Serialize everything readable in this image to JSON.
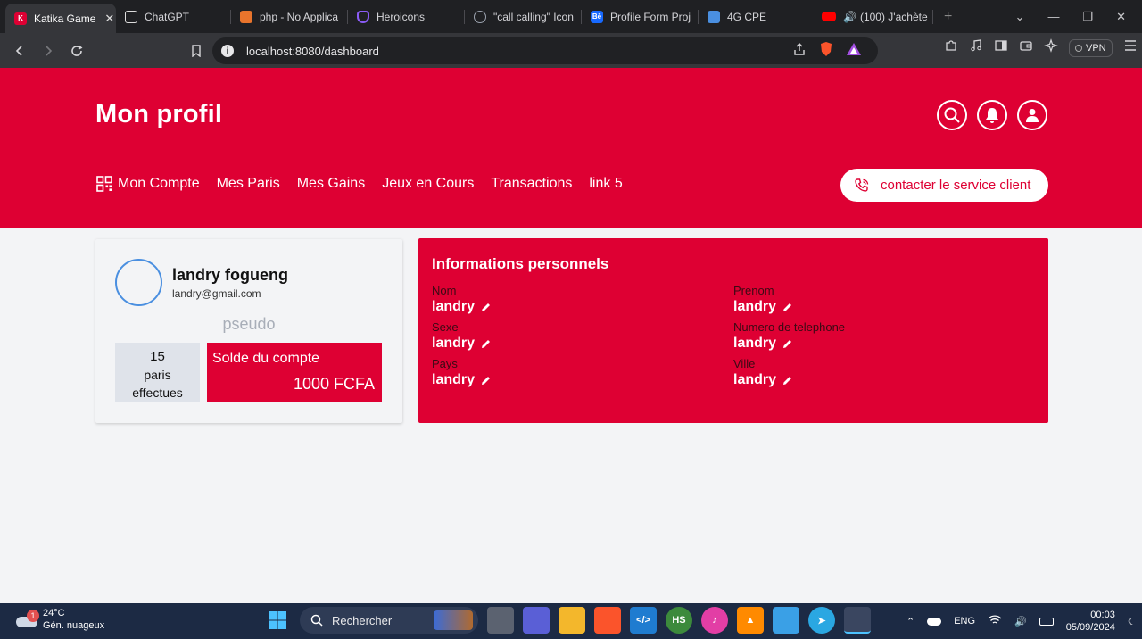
{
  "browser": {
    "tabs": [
      {
        "label": "Katika Game",
        "active": true,
        "color": "#de0033"
      },
      {
        "label": "ChatGPT",
        "active": false,
        "color": "#ffffff"
      },
      {
        "label": "php - No Applica",
        "active": false,
        "color": "#e8742c"
      },
      {
        "label": "Heroicons",
        "active": false,
        "color": "#8b5cf6"
      },
      {
        "label": "\"call calling\" Icon",
        "active": false,
        "color": "#9ca3af"
      },
      {
        "label": "Profile Form Proj",
        "active": false,
        "color": "#1769ff"
      },
      {
        "label": "4G CPE",
        "active": false,
        "color": "#4a8fe0"
      },
      {
        "label": "(100) J'achète",
        "active": false,
        "color": "#ff0000"
      }
    ],
    "url_host": "localhost",
    "url_path": ":8080/dashboard",
    "vpn_label": "VPN"
  },
  "header": {
    "title": "Mon profil",
    "nav": [
      "Mon Compte",
      "Mes Paris",
      "Mes Gains",
      "Jeux en Cours",
      "Transactions",
      "link 5"
    ],
    "contact_label": "contacter le service client"
  },
  "profile": {
    "name": "landry fogueng",
    "email": "landry@gmail.com",
    "pseudo": "pseudo",
    "paris_count": "15",
    "paris_label_1": "paris",
    "paris_label_2": "effectues",
    "solde_label": "Solde du compte",
    "solde_amount": "1000 FCFA"
  },
  "info": {
    "title": "Informations personnels",
    "fields": [
      {
        "label": "Nom",
        "value": "landry"
      },
      {
        "label": "Prenom",
        "value": "landry"
      },
      {
        "label": "Sexe",
        "value": "landry"
      },
      {
        "label": "Numero de telephone",
        "value": "landry"
      },
      {
        "label": "Pays",
        "value": "landry"
      },
      {
        "label": "Ville",
        "value": "landry"
      }
    ]
  },
  "taskbar": {
    "temperature": "24°C",
    "weather": "Gén. nuageux",
    "weather_badge": "1",
    "search_label": "Rechercher",
    "lang": "ENG",
    "time": "00:03",
    "date": "05/09/2024"
  },
  "colors": {
    "brand_red": "#de0033",
    "page_bg": "#f3f4f6"
  }
}
